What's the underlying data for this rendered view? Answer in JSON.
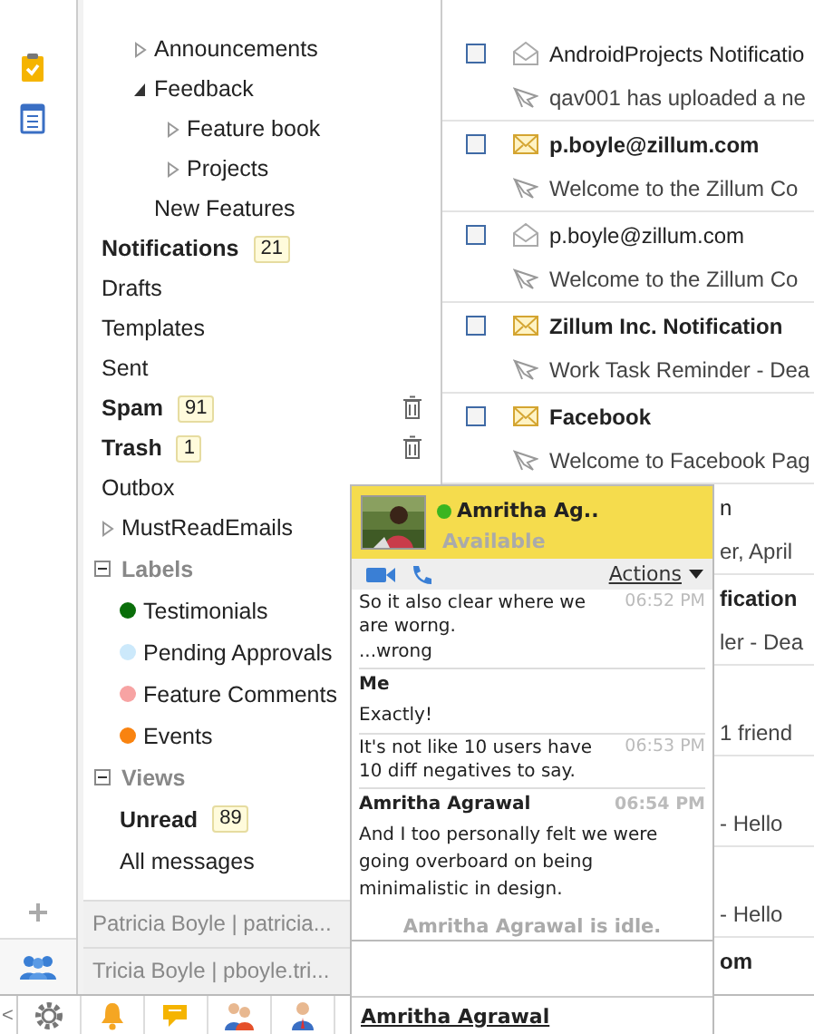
{
  "folders": [
    {
      "children": [
        {
          "children": [
            {
              "label": "Announcements",
              "expanded": false
            },
            {
              "label": "Feedback",
              "expanded": true,
              "children": [
                {
                  "label": "Feature book",
                  "expanded": false
                },
                {
                  "label": "Projects",
                  "expanded": false
                }
              ]
            },
            {
              "label": "New Features"
            }
          ]
        },
        {
          "label": "Notifications",
          "bold": true,
          "count": "21"
        }
      ]
    },
    {
      "label": "Drafts"
    },
    {
      "label": "Templates"
    },
    {
      "label": "Sent"
    },
    {
      "label": "Spam",
      "bold": true,
      "count": "91",
      "trash_icon": true
    },
    {
      "label": "Trash",
      "bold": true,
      "count": "1",
      "trash_icon": true
    },
    {
      "label": "Outbox"
    },
    {
      "label": "MustReadEmails",
      "expanded": false
    }
  ],
  "labels": {
    "title": "Labels",
    "expanded": true,
    "items": [
      {
        "label": "Testimonials",
        "color": "#0a6e0a"
      },
      {
        "label": "Pending Approvals",
        "color": "#cce9fb"
      },
      {
        "label": "Feature Comments",
        "color": "#f7a3a3"
      },
      {
        "label": "Events",
        "color": "#f98310"
      }
    ]
  },
  "views": {
    "title": "Views",
    "expanded": true,
    "items": [
      {
        "label": "Unread",
        "bold": true,
        "count": "89"
      },
      {
        "label": "All messages"
      }
    ]
  },
  "contacts": [
    "Patricia Boyle | patricia...",
    "Tricia Boyle | pboyle.tri..."
  ],
  "mails": [
    {
      "covered": false,
      "checked": false,
      "unread": false,
      "sender": "AndroidProjects Notificatio",
      "subject": "qav001 has uploaded a ne"
    },
    {
      "covered": false,
      "checked": false,
      "unread": true,
      "sender": "p.boyle@zillum.com",
      "subject": "Welcome to the Zillum Co"
    },
    {
      "covered": false,
      "checked": false,
      "unread": false,
      "sender": "p.boyle@zillum.com",
      "subject": "Welcome to the Zillum Co"
    },
    {
      "covered": false,
      "checked": false,
      "unread": true,
      "sender": "Zillum Inc. Notification",
      "subject": "Work Task Reminder - Dea"
    },
    {
      "covered": false,
      "checked": false,
      "unread": true,
      "sender": "Facebook",
      "subject": "Welcome to Facebook Pag"
    },
    {
      "covered": true,
      "unread": false,
      "sender": "n",
      "subject": "er, April"
    },
    {
      "covered": true,
      "unread": true,
      "sender": "fication",
      "subject": "ler - Dea"
    },
    {
      "covered": true,
      "subject": "1 friend"
    },
    {
      "covered": true,
      "subject": "- Hello"
    },
    {
      "covered": true,
      "subject": "- Hello"
    },
    {
      "covered": true,
      "unread": true,
      "sender": "om"
    }
  ],
  "chat": {
    "name": "Amritha Ag..",
    "online": true,
    "status": "Available",
    "actions": "Actions",
    "messages": [
      {
        "kind": "text",
        "text": "So it also clear where we are worng.",
        "time": "06:52 PM"
      },
      {
        "kind": "text",
        "text": "...wrong"
      },
      {
        "kind": "sender",
        "text": "Me"
      },
      {
        "kind": "text",
        "text": "Exactly!"
      },
      {
        "kind": "text",
        "text": "It's not like 10 users have 10 diff negatives to say.",
        "time": "06:53 PM"
      },
      {
        "kind": "sender",
        "text": "Amritha Agrawal",
        "time": "06:54 PM"
      },
      {
        "kind": "text",
        "text": "And I too personally felt we were going overboard on being minimalistic in design."
      }
    ],
    "notice": "Amritha Agrawal is idle.",
    "footer": "Amritha Agrawal"
  },
  "bottom_bar": {
    "collapse": "<"
  }
}
